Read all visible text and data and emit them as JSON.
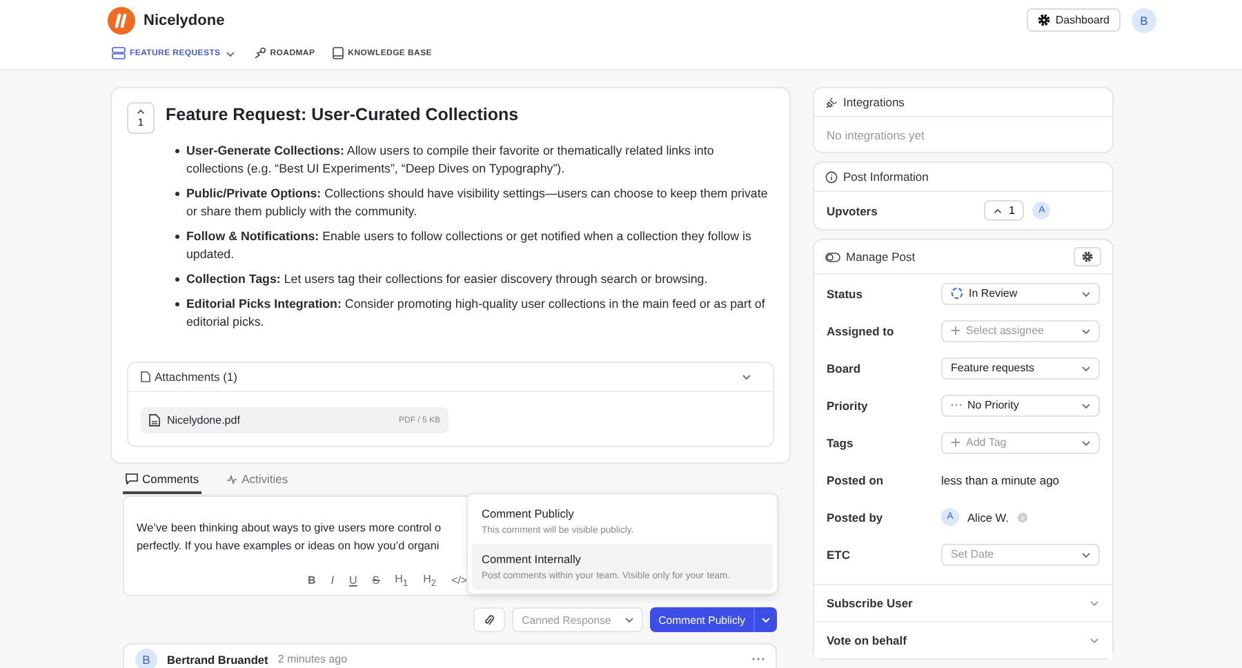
{
  "header": {
    "brand": "Nicelydone",
    "dashboard_button": "Dashboard",
    "avatar": "B"
  },
  "nav": [
    {
      "label": "FEATURE REQUESTS",
      "selected": true,
      "kind": "list"
    },
    {
      "label": "ROADMAP",
      "selected": false,
      "kind": "map"
    },
    {
      "label": "KNOWLEDGE BASE",
      "selected": false,
      "kind": "book"
    }
  ],
  "post": {
    "vote_count": "1",
    "title": "Feature Request: User-Curated Collections",
    "bullets": [
      "**User-Generate Collections:** Allow users to compile their favorite or thematically related links into collections (e.g. “Best UI Experiments”, “Deep Dives on Typography”).",
      "**Public/Private Options:** Collections should have visibility settings—users can choose to keep them private or share them publicly with the community.",
      "**Follow & Notifications:** Enable users to follow collections or get notified when a collection they follow is updated.",
      "**Collection Tags:** Let users tag their collections for easier discovery through search or browsing.",
      "**Editorial Picks Integration:** Consider promoting high-quality user collections in the main feed or as part of editorial picks."
    ],
    "attachments": {
      "title": "Attachments (1)",
      "files": [
        {
          "name": "Nicelydone.pdf",
          "meta": "PDF / 5 KB"
        }
      ]
    }
  },
  "comment_tabs": [
    {
      "label": "Comments",
      "selected": true,
      "kind": "comments"
    },
    {
      "label": "Activities",
      "selected": false,
      "kind": "activity"
    }
  ],
  "editor": {
    "lines": [
      "We’ve been thinking about ways to give users more control o",
      "perfectly. If you have examples or ideas on how you’d organi"
    ],
    "toolbar": [
      "B",
      "I",
      "U",
      "S",
      "H$_{1}$",
      "H$_{2}$",
      "</>"
    ]
  },
  "visibility_menu": [
    {
      "title": "Comment Publicly",
      "description": "This comment will be visible publicly.",
      "selected": false
    },
    {
      "title": "Comment Internally",
      "description": "Post comments within your team. Visible only for your team.",
      "selected": true
    }
  ],
  "actions": {
    "canned_response": "Canned Response",
    "submit": "Comment Publicly"
  },
  "comments": [
    {
      "avatar": "B",
      "author": "Bertrand Bruandet",
      "time": "2 minutes ago"
    }
  ],
  "integrations": {
    "title": "Integrations",
    "empty": "No integrations yet"
  },
  "post_information": {
    "title": "Post Information",
    "upvoters_label": "Upvoters",
    "upvote_count": "1",
    "upvoter_avatars": [
      "A"
    ]
  },
  "manage_post": {
    "title": "Manage Post",
    "fields": [
      {
        "label": "Status",
        "kind": "status",
        "value": "In Review"
      },
      {
        "label": "Assigned to",
        "kind": "add",
        "placeholder": "Select assignee"
      },
      {
        "label": "Board",
        "kind": "select",
        "value": "Feature requests"
      },
      {
        "label": "Priority",
        "kind": "priority",
        "value": "No Priority"
      },
      {
        "label": "Tags",
        "kind": "add",
        "placeholder": "Add Tag"
      },
      {
        "label": "Posted on",
        "kind": "text",
        "value": "less than a minute ago"
      },
      {
        "label": "Posted by",
        "kind": "user",
        "avatar": "A",
        "value": "Alice W."
      },
      {
        "label": "ETC",
        "kind": "select",
        "placeholder": "Set Date"
      }
    ],
    "sections": [
      {
        "label": "Subscribe User",
        "expanded": false
      },
      {
        "label": "Vote on behalf",
        "expanded": false
      }
    ]
  }
}
